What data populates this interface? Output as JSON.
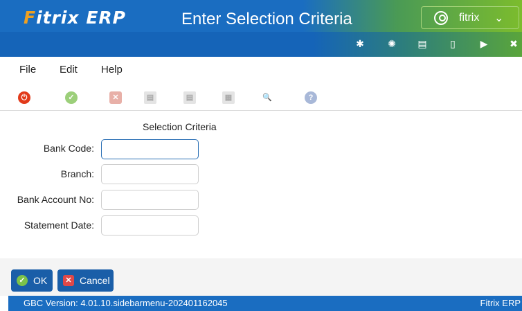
{
  "header": {
    "logo_prefix": "F",
    "logo_rest": "itrix ERP",
    "window_title": "Enter Selection Criteria",
    "user_name": "fitrix",
    "chevron": "⌄",
    "icons": [
      "gear-icon",
      "settings-icon",
      "document-icon",
      "new-document-icon",
      "play-icon",
      "close-icon"
    ]
  },
  "menu": {
    "items": [
      "File",
      "Edit",
      "Help"
    ]
  },
  "toolbar": {
    "icons": [
      "power-icon",
      "accept-icon",
      "cancel-icon",
      "copy-icon",
      "paste-icon",
      "grid-icon",
      "zoom-icon",
      "help-icon"
    ]
  },
  "form": {
    "section_title": "Selection Criteria",
    "fields": [
      {
        "label": "Bank Code:",
        "value": ""
      },
      {
        "label": "Branch:",
        "value": ""
      },
      {
        "label": "Bank Account No:",
        "value": ""
      },
      {
        "label": "Statement Date:",
        "value": ""
      }
    ]
  },
  "buttons": {
    "ok_label": "OK",
    "cancel_label": "Cancel"
  },
  "status": {
    "version": "GBC Version: 4.01.10.sidebarmenu-202401162045",
    "app_name": "Fitrix ERP"
  },
  "colors": {
    "brand_blue": "#1a6dc1",
    "brand_green": "#7cbc2d",
    "logo_orange": "#f0a020",
    "button_blue": "#1a5ea8"
  }
}
